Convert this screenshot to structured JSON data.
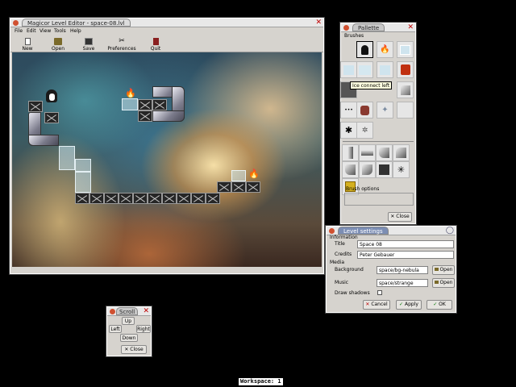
{
  "main_window": {
    "title": "Magicor Level Editor - space-08.lvl",
    "menu": [
      "File",
      "Edit",
      "View",
      "Tools",
      "Help"
    ],
    "toolbar": [
      {
        "label": "New",
        "icon": "new-file-icon"
      },
      {
        "label": "Open",
        "icon": "folder-open-icon"
      },
      {
        "label": "Save",
        "icon": "floppy-save-icon"
      },
      {
        "label": "Preferences",
        "icon": "preferences-icon"
      },
      {
        "label": "Quit",
        "icon": "quit-icon"
      }
    ]
  },
  "palette": {
    "title": "Pallette",
    "brushes_label": "Brushes",
    "tooltip": "Ice connect left",
    "brush_options_label": "Brush options",
    "close_label": "Close"
  },
  "level_settings": {
    "title": "Level settings",
    "information_label": "Information",
    "title_label": "Title",
    "title_value": "Space 08",
    "credits_label": "Credits",
    "credits_value": "Peter Gebauer",
    "media_label": "Media",
    "background_label": "Background",
    "background_value": "space/bg-nebula",
    "music_label": "Music",
    "music_value": "space/strange",
    "open_label": "Open",
    "draw_shadows_label": "Draw shadows",
    "cancel_label": "Cancel",
    "apply_label": "Apply",
    "ok_label": "OK"
  },
  "scroll": {
    "title": "Scroll",
    "up": "Up",
    "left": "Left",
    "right": "Right",
    "down": "Down",
    "close": "Close"
  },
  "workspace": {
    "label": "Workspace: 1"
  }
}
